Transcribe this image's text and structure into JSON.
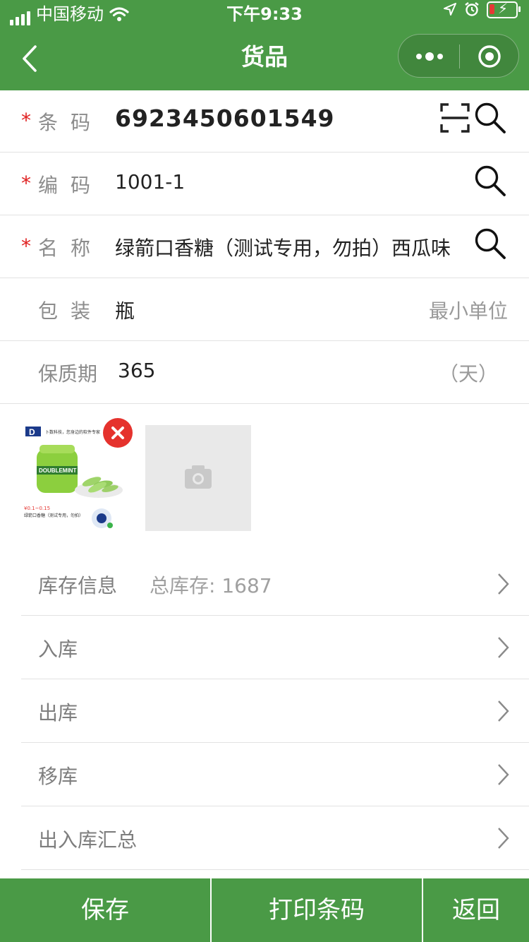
{
  "status_bar": {
    "carrier": "中国移动",
    "time": "下午9:33",
    "icons": [
      "signal-icon",
      "wifi-icon",
      "location-icon",
      "alarm-icon",
      "battery-charging-icon"
    ]
  },
  "nav": {
    "title": "货品",
    "back_icon": "chevron-left-icon",
    "more_icon": "more-dots-icon",
    "close_icon": "target-icon"
  },
  "form": {
    "barcode": {
      "label": "条码",
      "value": "6923450601549",
      "required": "*"
    },
    "code": {
      "label": "编码",
      "value": "1001-1",
      "required": "*"
    },
    "name": {
      "label": "名称",
      "value": "绿箭口香糖（测试专用，勿拍）西瓜味",
      "required": "*"
    },
    "package": {
      "label": "包装",
      "value": "瓶",
      "hint": "最小单位"
    },
    "shelf_life": {
      "label": "保质期",
      "value": "365",
      "hint": "（天）"
    }
  },
  "product_image": {
    "brand": "DOUBLEMINT",
    "caption": "绿箭口香糖（测试专用，勿拍）",
    "price": "¥0.1~0.15",
    "top_text": "卜数科技，您身边的软件专家"
  },
  "links": [
    {
      "label": "库存信息",
      "sub": "总库存:   1687"
    },
    {
      "label": "入库",
      "sub": ""
    },
    {
      "label": "出库",
      "sub": ""
    },
    {
      "label": "移库",
      "sub": ""
    },
    {
      "label": "出入库汇总",
      "sub": ""
    }
  ],
  "bottom": {
    "save": "保存",
    "print": "打印条码",
    "back": "返回"
  },
  "colors": {
    "brand_green": "#4a9a46",
    "required_red": "#e02020",
    "delete_red": "#e5322d"
  }
}
